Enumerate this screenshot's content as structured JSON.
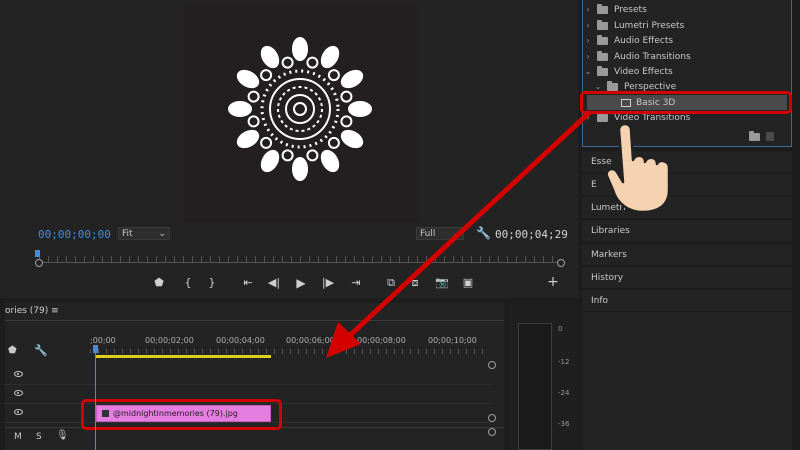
{
  "program_monitor": {
    "timecode_current": "00;00;00;00",
    "timecode_duration": "00;00;04;29",
    "fit_select": "Fit",
    "resolution_select": "Full"
  },
  "transport": {
    "buttons": [
      "marker",
      "mark-in",
      "mark-out",
      "go-to-in",
      "step-back",
      "play",
      "step-forward",
      "go-to-out",
      "insert",
      "overwrite",
      "export-frame",
      "compare",
      "add"
    ]
  },
  "effects_panel": {
    "items": [
      {
        "label": "Presets",
        "expanded": false,
        "level": 0
      },
      {
        "label": "Lumetri Presets",
        "expanded": false,
        "level": 0
      },
      {
        "label": "Audio Effects",
        "expanded": false,
        "level": 0
      },
      {
        "label": "Audio Transitions",
        "expanded": false,
        "level": 0
      },
      {
        "label": "Video Effects",
        "expanded": true,
        "level": 0
      },
      {
        "label": "Perspective",
        "expanded": true,
        "level": 1
      },
      {
        "label": "Basic 3D",
        "selected": true,
        "level": 2
      },
      {
        "label": "Video Transitions",
        "expanded": false,
        "level": 0
      }
    ]
  },
  "panels": {
    "essential": "Esse",
    "effect_controls": "E",
    "lumetri": "Lumetri Co",
    "libraries": "Libraries",
    "markers": "Markers",
    "history": "History",
    "info": "Info"
  },
  "timeline": {
    "tab_label": "ories (79)",
    "ruler_labels": [
      ";00;00",
      "00;00;02;00",
      "00;00;04;00",
      "00;00;06;00",
      "00;00;08;00",
      "00;00;10;00"
    ],
    "clip_name": "@midnightinmemories (79).jpg",
    "track_controls": [
      "M",
      "S"
    ]
  },
  "audio_meter": {
    "labels": [
      "0",
      "-12",
      "-24",
      "-36"
    ]
  },
  "colors": {
    "accent_blue": "#3f8fe0",
    "highlight_red": "#d40000",
    "clip_pink": "#e57ee0",
    "workbar_yellow": "#e0d020"
  }
}
